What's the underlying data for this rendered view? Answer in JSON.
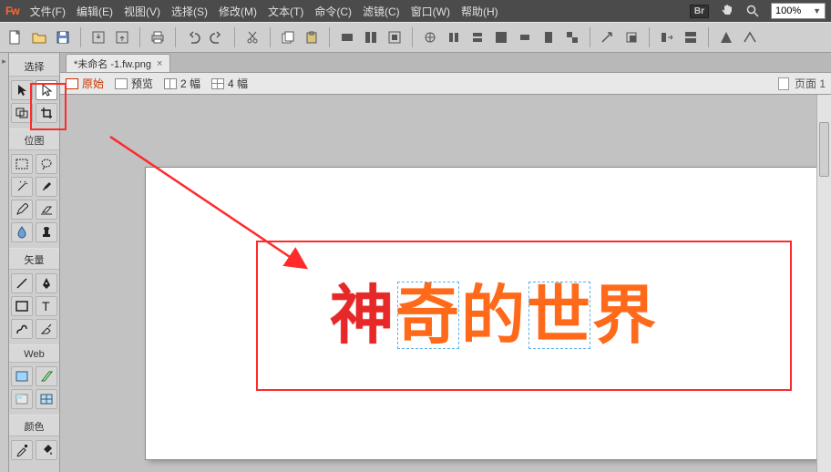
{
  "app": {
    "logo": "Fw"
  },
  "menu": {
    "file": "文件(F)",
    "edit": "编辑(E)",
    "view": "视图(V)",
    "select": "选择(S)",
    "modify": "修改(M)",
    "text": "文本(T)",
    "command": "命令(C)",
    "filter": "滤镜(C)",
    "window": "窗口(W)",
    "help": "帮助(H)",
    "br_badge": "Br",
    "zoom": "100%"
  },
  "document": {
    "tab_title": "*未命名 -1.fw.png",
    "close_glyph": "×"
  },
  "views": {
    "original": "原始",
    "preview": "预览",
    "split2": "2 幅",
    "split4": "4 幅",
    "page_label": "页面 1"
  },
  "tools_sections": {
    "select": "选择",
    "bitmap": "位图",
    "vector": "矢量",
    "web": "Web",
    "color": "颜色"
  },
  "canvas_text": {
    "c1": "神",
    "c2": "奇",
    "c3": "的",
    "c4": "世",
    "c5": "界"
  },
  "annotation": {
    "arrow_color": "#ff2a2a",
    "box_color": "#ff2a2a"
  }
}
